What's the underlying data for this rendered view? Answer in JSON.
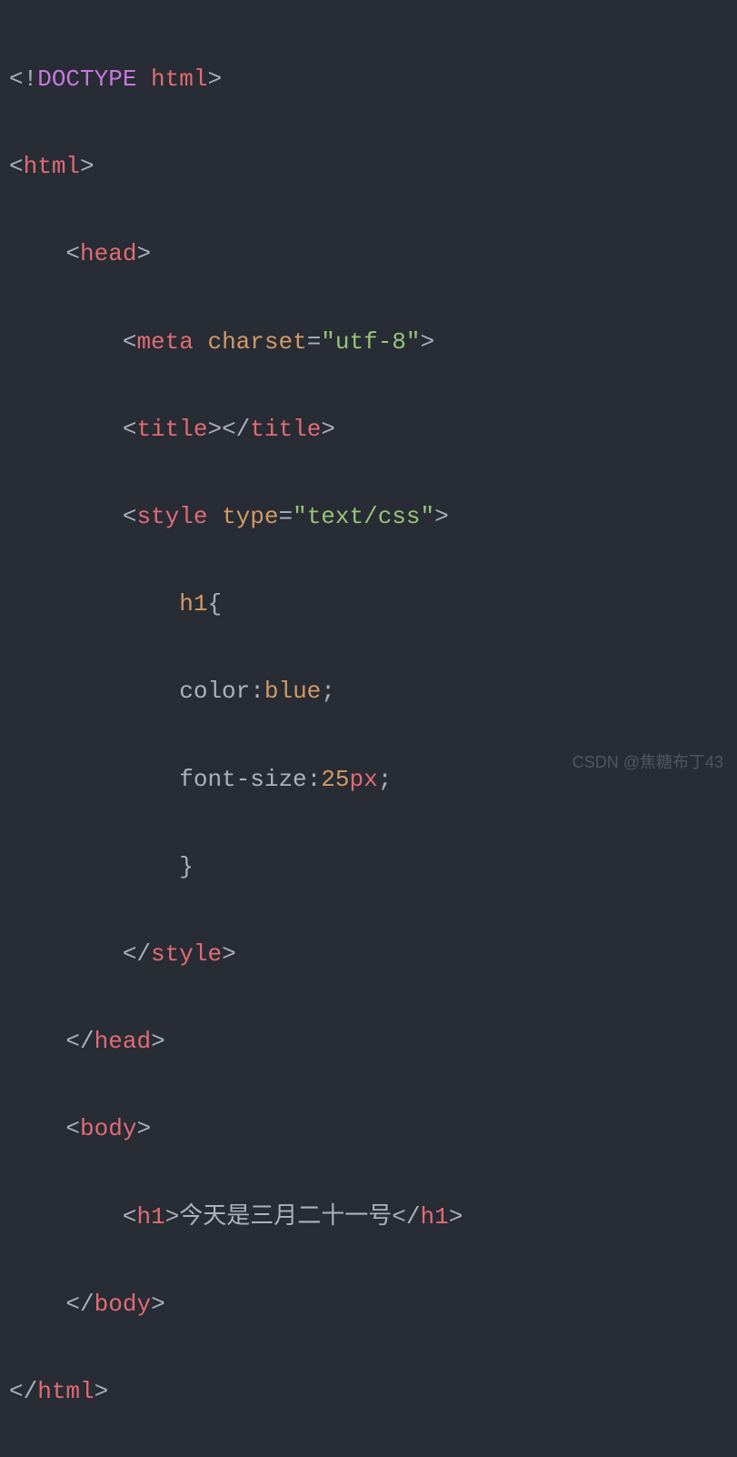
{
  "code": {
    "l1": {
      "bang": "<!",
      "doctype": "DOCTYPE",
      "htmlword": "html",
      "close": ">"
    },
    "l2": {
      "open": "<",
      "tag": "html",
      "close": ">"
    },
    "l3": {
      "open": "<",
      "tag": "head",
      "close": ">"
    },
    "l4": {
      "open": "<",
      "tag": "meta",
      "attr": "charset",
      "eq": "=",
      "val": "\"utf-8\"",
      "close": ">"
    },
    "l5": {
      "open": "<",
      "tag": "title",
      "close1": ">",
      "open2": "</",
      "tag2": "title",
      "close2": ">"
    },
    "l6": {
      "open": "<",
      "tag": "style",
      "attr": "type",
      "eq": "=",
      "val": "\"text/css\"",
      "close": ">"
    },
    "l7": {
      "sel": "h1",
      "brace": "{"
    },
    "l8": {
      "prop": "color",
      "colon": ":",
      "val": "blue",
      "semi": ";"
    },
    "l9": {
      "prop": "font-size",
      "colon": ":",
      "num": "25",
      "unit": "px",
      "semi": ";"
    },
    "l10": {
      "brace": "}"
    },
    "l11": {
      "open": "</",
      "tag": "style",
      "close": ">"
    },
    "l12": {
      "open": "</",
      "tag": "head",
      "close": ">"
    },
    "l13": {
      "open": "<",
      "tag": "body",
      "close": ">"
    },
    "l14": {
      "open": "<",
      "tag": "h1",
      "close1": ">",
      "text": "今天是三月二十一号",
      "open2": "</",
      "tag2": "h1",
      "close2": ">"
    },
    "l15": {
      "open": "</",
      "tag": "body",
      "close": ">"
    },
    "l16": {
      "open": "</",
      "tag": "html",
      "close": ">"
    }
  },
  "watermark": "CSDN @焦糖布丁43"
}
